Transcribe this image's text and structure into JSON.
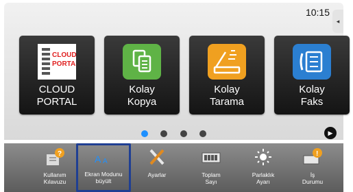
{
  "status": {
    "time": "10:15"
  },
  "tiles": [
    {
      "label_lines": [
        "CLOUD PORTAL",
        ""
      ],
      "logo_text": [
        "CLOUD",
        "PORTAL"
      ]
    },
    {
      "label_lines": [
        "Kolay",
        "Kopya"
      ]
    },
    {
      "label_lines": [
        "Kolay",
        "Tarama"
      ]
    },
    {
      "label_lines": [
        "Kolay",
        "Faks"
      ]
    }
  ],
  "pager": {
    "pages": 4,
    "active_index": 0
  },
  "quick_bar": [
    {
      "line1": "Kullanım",
      "line2": "Kılavuzu",
      "icon": "manual-icon"
    },
    {
      "line1": "Ekran Modunu",
      "line2": "büyült",
      "icon": "magnify-mode-icon",
      "selected": true
    },
    {
      "line1": "Ayarlar",
      "line2": "",
      "icon": "settings-tools-icon"
    },
    {
      "line1": "Toplam",
      "line2": "Sayı",
      "icon": "counter-icon"
    },
    {
      "line1": "Parlaklık",
      "line2": "Ayarı",
      "icon": "brightness-icon"
    },
    {
      "line1": "İş",
      "line2": "Durumu",
      "icon": "job-status-icon"
    }
  ],
  "colors": {
    "selection_frame": "#1f3f93",
    "active_dot": "#1e90ff",
    "copy_green": "#5fb346",
    "scan_orange": "#f0a020",
    "fax_blue": "#2b7fd1",
    "cloud_red": "#e02020"
  }
}
